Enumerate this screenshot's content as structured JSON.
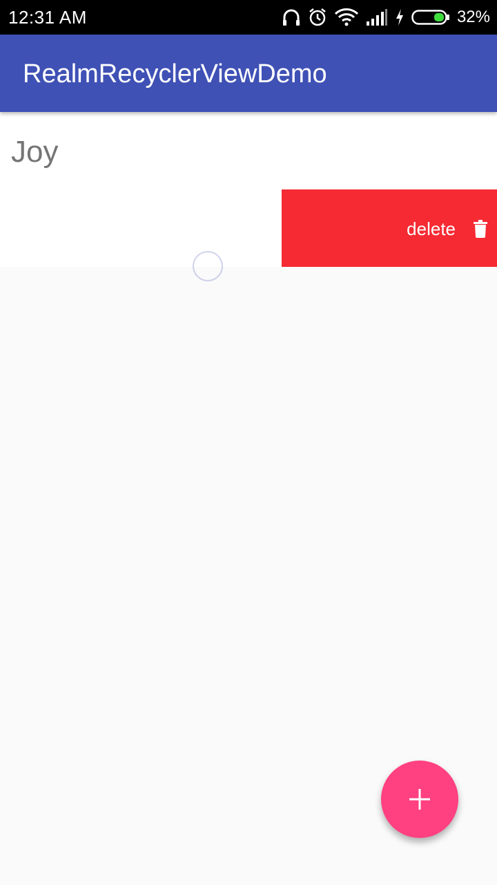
{
  "status_bar": {
    "time": "12:31 AM",
    "battery_percent": "32%",
    "icons": [
      "headphones-icon",
      "alarm-icon",
      "wifi-icon",
      "signal-icon",
      "charging-icon",
      "battery-icon"
    ]
  },
  "app_bar": {
    "title": "RealmRecyclerViewDemo",
    "color": "#3f51b5"
  },
  "list": {
    "items": [
      {
        "name": "Joy"
      }
    ],
    "swiped_item": {
      "action_label": "delete",
      "action_icon": "trash-icon",
      "action_color": "#f52a33"
    }
  },
  "fab": {
    "icon": "plus-icon",
    "color": "#ff4081"
  }
}
